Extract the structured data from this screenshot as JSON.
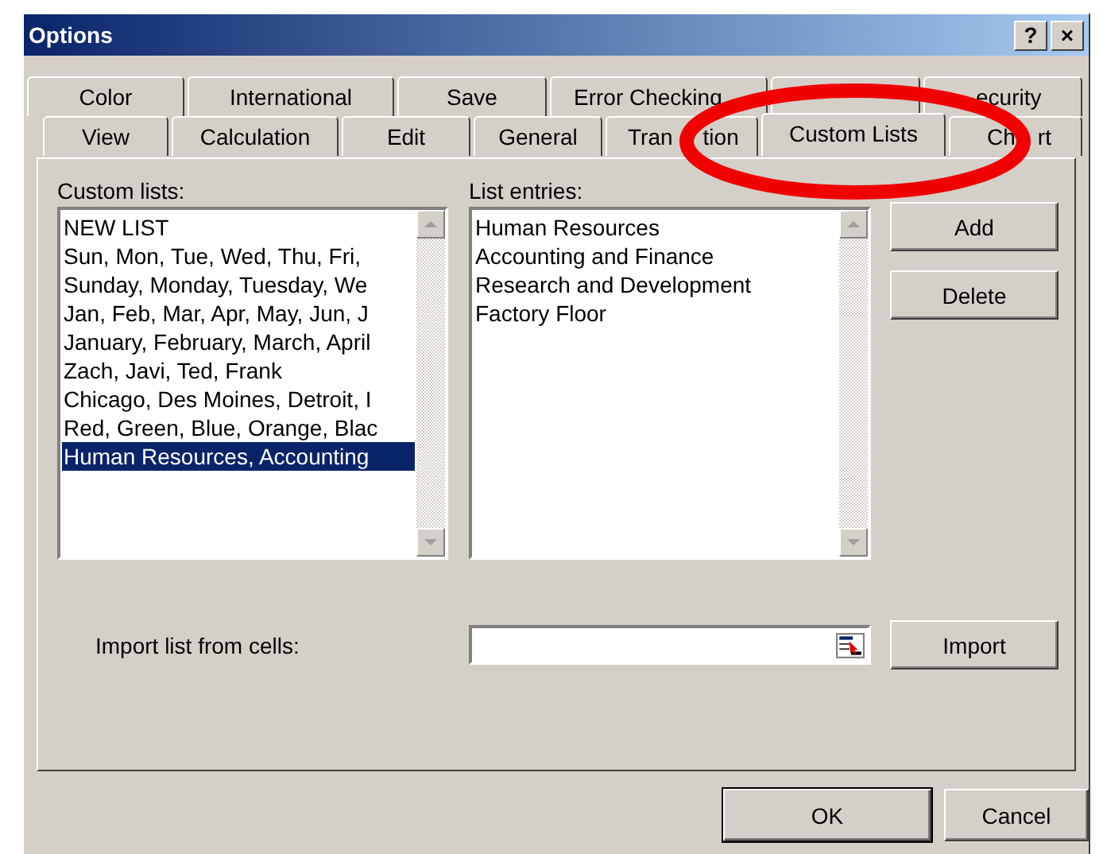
{
  "window": {
    "title": "Options",
    "help_button": "?",
    "close_button": "×"
  },
  "tab_rows": [
    [
      {
        "pieces": [
          "Color"
        ],
        "selected": false
      },
      {
        "pieces": [
          "International"
        ],
        "selected": false
      },
      {
        "pieces": [
          "Save"
        ],
        "selected": false
      },
      {
        "pieces": [
          "Error Checking"
        ],
        "selected": false
      },
      {
        "selected": false
      },
      {
        "pieces": [
          "ecurity"
        ],
        "selected": false
      }
    ],
    [
      {
        "pieces": [
          "View"
        ],
        "selected": false
      },
      {
        "pieces": [
          "Calculation"
        ],
        "selected": false
      },
      {
        "pieces": [
          "Edit"
        ],
        "selected": false
      },
      {
        "pieces": [
          "General"
        ],
        "selected": false
      },
      {
        "pieces": [
          "Tran",
          "tion"
        ],
        "selected": false
      },
      {
        "pieces": [
          "Custom Lists"
        ],
        "selected": true
      },
      {
        "pieces": [
          "Ch",
          "rt"
        ],
        "selected": false
      }
    ]
  ],
  "custom_lists": {
    "label": "Custom lists:",
    "items": [
      {
        "text": "NEW LIST",
        "selected": false
      },
      {
        "text": "Sun, Mon, Tue, Wed, Thu, Fri,",
        "selected": false
      },
      {
        "text": "Sunday, Monday, Tuesday, We",
        "selected": false
      },
      {
        "text": "Jan, Feb, Mar, Apr, May, Jun, J",
        "selected": false
      },
      {
        "text": "January, February, March, April",
        "selected": false
      },
      {
        "text": "Zach, Javi, Ted, Frank",
        "selected": false
      },
      {
        "text": "Chicago, Des Moines, Detroit, I",
        "selected": false
      },
      {
        "text": "Red, Green, Blue, Orange, Blac",
        "selected": false
      },
      {
        "text": "Human Resources, Accounting",
        "selected": true
      }
    ]
  },
  "list_entries": {
    "label": "List entries:",
    "lines": [
      "Human Resources",
      "Accounting and Finance",
      "Research and Development",
      "Factory Floor"
    ]
  },
  "side_buttons": [
    "Add",
    "Delete"
  ],
  "import": {
    "label": "Import list from cells:",
    "button": "Import"
  },
  "footer_buttons": [
    "OK",
    "Cancel"
  ]
}
